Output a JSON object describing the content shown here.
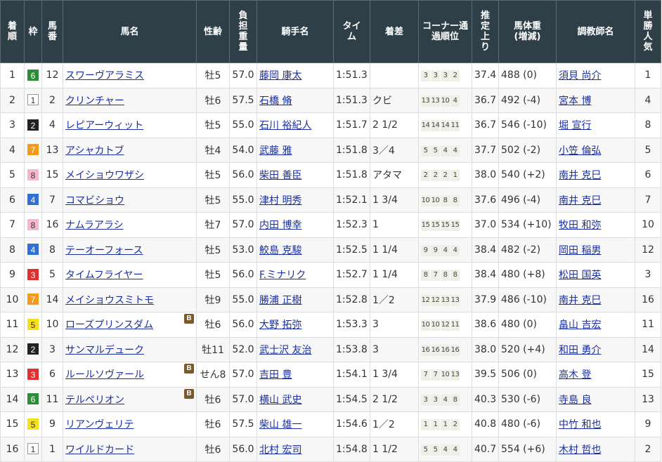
{
  "headers": {
    "rank": "着順",
    "waku": "枠",
    "umaban": "馬番",
    "horse": "馬名",
    "sex_age": "性齢",
    "weight_carried": "負担重量",
    "jockey": "騎手名",
    "time": "タイム",
    "margin": "着差",
    "corner": "コーナー通過順位",
    "last3f": "推定上り",
    "body_weight": "馬体重(増減)",
    "trainer": "調教師名",
    "popularity": "単勝人気"
  },
  "waku_colors": {
    "1": {
      "bg": "#ffffff",
      "fg": "#333333",
      "border": "#999999"
    },
    "2": {
      "bg": "#222222",
      "fg": "#ffffff",
      "border": "#222222"
    },
    "3": {
      "bg": "#e03030",
      "fg": "#ffffff",
      "border": "#e03030"
    },
    "4": {
      "bg": "#2f6fd6",
      "fg": "#ffffff",
      "border": "#2f6fd6"
    },
    "5": {
      "bg": "#f5e11a",
      "fg": "#333333",
      "border": "#f5e11a"
    },
    "6": {
      "bg": "#2e8b3a",
      "fg": "#ffffff",
      "border": "#2e8b3a"
    },
    "7": {
      "bg": "#f39a1d",
      "fg": "#ffffff",
      "border": "#f39a1d"
    },
    "8": {
      "bg": "#f6b7cb",
      "fg": "#333333",
      "border": "#f6b7cb"
    }
  },
  "rows": [
    {
      "rank": "1",
      "waku": "6",
      "umaban": "12",
      "horse": "スワーヴアラミス",
      "blinker": "",
      "sex_age": "牡5",
      "weight": "57.0",
      "jockey": "藤岡 康太",
      "time": "1:51.3",
      "margin": "",
      "corner": [
        "3",
        "3",
        "3",
        "2"
      ],
      "last3f": "37.4",
      "body_weight": "488 (0)",
      "trainer": "須貝 尚介",
      "popularity": "1"
    },
    {
      "rank": "2",
      "waku": "1",
      "umaban": "2",
      "horse": "クリンチャー",
      "blinker": "",
      "sex_age": "牡6",
      "weight": "57.5",
      "jockey": "石橋 脩",
      "time": "1:51.3",
      "margin": "クビ",
      "corner": [
        "13",
        "13",
        "10",
        "4"
      ],
      "last3f": "36.7",
      "body_weight": "492 (-4)",
      "trainer": "宮本 博",
      "popularity": "4"
    },
    {
      "rank": "3",
      "waku": "2",
      "umaban": "4",
      "horse": "レピアーウィット",
      "blinker": "",
      "sex_age": "牡5",
      "weight": "55.0",
      "jockey": "石川 裕紀人",
      "time": "1:51.7",
      "margin": "2 1/2",
      "corner": [
        "14",
        "14",
        "14",
        "11"
      ],
      "last3f": "36.7",
      "body_weight": "546 (-10)",
      "trainer": "堀 宣行",
      "popularity": "8"
    },
    {
      "rank": "4",
      "waku": "7",
      "umaban": "13",
      "horse": "アシャカトブ",
      "blinker": "",
      "sex_age": "牡4",
      "weight": "54.0",
      "jockey": "武藤 雅",
      "time": "1:51.8",
      "margin": "3／4",
      "corner": [
        "5",
        "5",
        "4",
        "4"
      ],
      "last3f": "37.7",
      "body_weight": "502 (-2)",
      "trainer": "小笠 倫弘",
      "popularity": "5"
    },
    {
      "rank": "5",
      "waku": "8",
      "umaban": "15",
      "horse": "メイショウワザシ",
      "blinker": "",
      "sex_age": "牡5",
      "weight": "56.0",
      "jockey": "柴田 善臣",
      "time": "1:51.8",
      "margin": "アタマ",
      "corner": [
        "2",
        "2",
        "2",
        "1"
      ],
      "last3f": "38.0",
      "body_weight": "540 (+2)",
      "trainer": "南井 克巳",
      "popularity": "6"
    },
    {
      "rank": "6",
      "waku": "4",
      "umaban": "7",
      "horse": "コマビショウ",
      "blinker": "",
      "sex_age": "牡5",
      "weight": "55.0",
      "jockey": "津村 明秀",
      "time": "1:52.1",
      "margin": "1 3/4",
      "corner": [
        "10",
        "10",
        "8",
        "8"
      ],
      "last3f": "37.6",
      "body_weight": "496 (-4)",
      "trainer": "南井 克巳",
      "popularity": "7"
    },
    {
      "rank": "7",
      "waku": "8",
      "umaban": "16",
      "horse": "ナムラアラシ",
      "blinker": "",
      "sex_age": "牡7",
      "weight": "57.0",
      "jockey": "内田 博幸",
      "time": "1:52.3",
      "margin": "1",
      "corner": [
        "15",
        "15",
        "15",
        "15"
      ],
      "last3f": "37.0",
      "body_weight": "534 (+10)",
      "trainer": "牧田 和弥",
      "popularity": "10"
    },
    {
      "rank": "8",
      "waku": "4",
      "umaban": "8",
      "horse": "テーオーフォース",
      "blinker": "",
      "sex_age": "牡5",
      "weight": "53.0",
      "jockey": "鮫島 克駿",
      "time": "1:52.5",
      "margin": "1 1/4",
      "corner": [
        "9",
        "9",
        "4",
        "4"
      ],
      "last3f": "38.4",
      "body_weight": "482 (-2)",
      "trainer": "岡田 稲男",
      "popularity": "12"
    },
    {
      "rank": "9",
      "waku": "3",
      "umaban": "5",
      "horse": "タイムフライヤー",
      "blinker": "",
      "sex_age": "牡5",
      "weight": "56.0",
      "jockey": "F.ミナリク",
      "time": "1:52.7",
      "margin": "1 1/4",
      "corner": [
        "8",
        "7",
        "8",
        "8"
      ],
      "last3f": "38.4",
      "body_weight": "480 (+8)",
      "trainer": "松田 国英",
      "popularity": "3"
    },
    {
      "rank": "10",
      "waku": "7",
      "umaban": "14",
      "horse": "メイショウスミトモ",
      "blinker": "",
      "sex_age": "牡9",
      "weight": "55.0",
      "jockey": "勝浦 正樹",
      "time": "1:52.8",
      "margin": "1／2",
      "corner": [
        "12",
        "12",
        "13",
        "13"
      ],
      "last3f": "37.9",
      "body_weight": "486 (-10)",
      "trainer": "南井 克巳",
      "popularity": "16"
    },
    {
      "rank": "11",
      "waku": "5",
      "umaban": "10",
      "horse": "ローズプリンスダム",
      "blinker": "B",
      "sex_age": "牡6",
      "weight": "56.0",
      "jockey": "大野 拓弥",
      "time": "1:53.3",
      "margin": "3",
      "corner": [
        "10",
        "10",
        "12",
        "11"
      ],
      "last3f": "38.6",
      "body_weight": "480 (0)",
      "trainer": "畠山 吉宏",
      "popularity": "11"
    },
    {
      "rank": "12",
      "waku": "2",
      "umaban": "3",
      "horse": "サンマルデューク",
      "blinker": "",
      "sex_age": "牡11",
      "weight": "52.0",
      "jockey": "武士沢 友治",
      "time": "1:53.8",
      "margin": "3",
      "corner": [
        "16",
        "16",
        "16",
        "16"
      ],
      "last3f": "38.0",
      "body_weight": "520 (+4)",
      "trainer": "和田 勇介",
      "popularity": "14"
    },
    {
      "rank": "13",
      "waku": "3",
      "umaban": "6",
      "horse": "ルールソヴァール",
      "blinker": "B",
      "sex_age": "せん8",
      "weight": "57.0",
      "jockey": "吉田 豊",
      "time": "1:54.1",
      "margin": "1 3/4",
      "corner": [
        "7",
        "7",
        "10",
        "13"
      ],
      "last3f": "39.5",
      "body_weight": "506 (0)",
      "trainer": "高木 登",
      "popularity": "15"
    },
    {
      "rank": "14",
      "waku": "6",
      "umaban": "11",
      "horse": "テルペリオン",
      "blinker": "B",
      "sex_age": "牡6",
      "weight": "57.0",
      "jockey": "横山 武史",
      "time": "1:54.5",
      "margin": "2 1/2",
      "corner": [
        "3",
        "3",
        "4",
        "8"
      ],
      "last3f": "40.3",
      "body_weight": "530 (-6)",
      "trainer": "寺島 良",
      "popularity": "13"
    },
    {
      "rank": "15",
      "waku": "5",
      "umaban": "9",
      "horse": "リアンヴェリテ",
      "blinker": "",
      "sex_age": "牡6",
      "weight": "57.5",
      "jockey": "柴山 雄一",
      "time": "1:54.6",
      "margin": "1／2",
      "corner": [
        "1",
        "1",
        "1",
        "2"
      ],
      "last3f": "40.8",
      "body_weight": "480 (-6)",
      "trainer": "中竹 和也",
      "popularity": "9"
    },
    {
      "rank": "16",
      "waku": "1",
      "umaban": "1",
      "horse": "ワイルドカード",
      "blinker": "",
      "sex_age": "牡6",
      "weight": "56.0",
      "jockey": "北村 宏司",
      "time": "1:54.8",
      "margin": "1 1/2",
      "corner": [
        "5",
        "5",
        "4",
        "4"
      ],
      "last3f": "40.7",
      "body_weight": "554 (+6)",
      "trainer": "木村 哲也",
      "popularity": "2"
    }
  ]
}
